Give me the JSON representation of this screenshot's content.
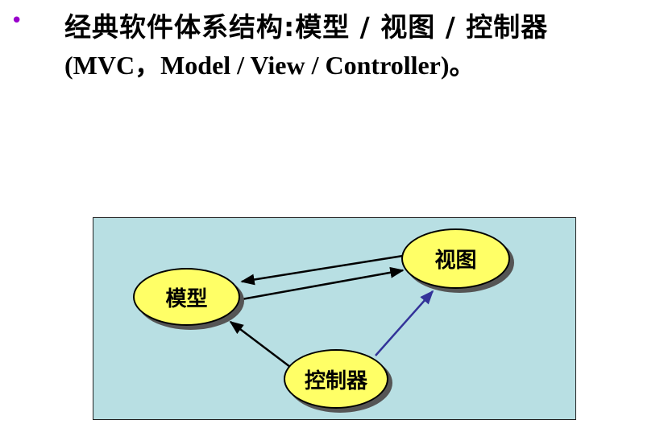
{
  "slide": {
    "bullet": "•",
    "title_line1": "经典软件体系结构:模型 / 视图 / 控制器",
    "title_line2": "(MVC，Model / View / Controller)。"
  },
  "diagram": {
    "nodes": {
      "model": "模型",
      "view": "视图",
      "controller": "控制器"
    },
    "colors": {
      "background": "#b8dfe3",
      "node_fill": "#ffff66",
      "arrow_black": "#000000",
      "arrow_blue": "#333399",
      "bullet": "#9900cc"
    }
  }
}
